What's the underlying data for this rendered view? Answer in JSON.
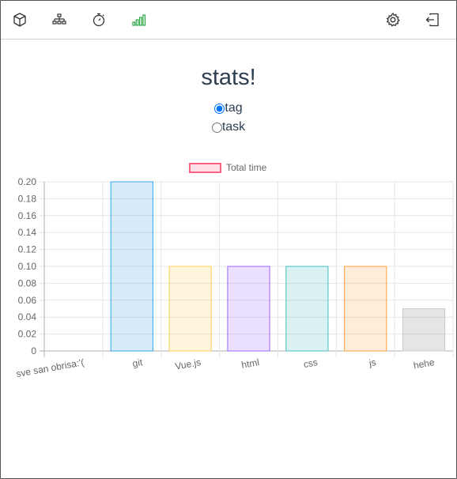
{
  "page": {
    "title": "stats!",
    "radios": [
      {
        "label": "tag",
        "checked": true
      },
      {
        "label": "task",
        "checked": false
      }
    ],
    "legend": {
      "label": "Total time"
    }
  },
  "nav": {
    "left_icons": [
      "cube-icon",
      "sitemap-icon",
      "stopwatch-icon",
      "signal-bars-icon"
    ],
    "right_icons": [
      "gear-icon",
      "logout-icon"
    ],
    "active_color": "#28a745"
  },
  "chart_data": {
    "type": "bar",
    "categories": [
      "sve san obrisa:'(",
      "git",
      "Vue.js",
      "html",
      "css",
      "js",
      "hehe"
    ],
    "series": [
      {
        "name": "Total time",
        "values": [
          0,
          0.2,
          0.1,
          0.1,
          0.1,
          0.1,
          0.05
        ]
      }
    ],
    "colors": [
      {
        "fill": "rgba(255,99,132,0.2)",
        "stroke": "rgba(255,99,132,1)"
      },
      {
        "fill": "rgba(54,162,235,0.2)",
        "stroke": "rgba(54,162,235,1)"
      },
      {
        "fill": "rgba(255,206,86,0.2)",
        "stroke": "rgba(255,206,86,1)"
      },
      {
        "fill": "rgba(153,102,255,0.2)",
        "stroke": "rgba(153,102,255,1)"
      },
      {
        "fill": "rgba(75,192,192,0.2)",
        "stroke": "rgba(75,192,192,1)"
      },
      {
        "fill": "rgba(255,159,64,0.2)",
        "stroke": "rgba(255,159,64,1)"
      },
      {
        "fill": "rgba(150,150,150,0.25)",
        "stroke": "rgba(201,203,207,1)"
      }
    ],
    "ylim": [
      0,
      0.2
    ],
    "yticks": [
      "0.20",
      "0.18",
      "0.16",
      "0.14",
      "0.12",
      "0.10",
      "0.08",
      "0.06",
      "0.04",
      "0.02",
      "0"
    ],
    "grid": true,
    "legend_position": "top"
  }
}
